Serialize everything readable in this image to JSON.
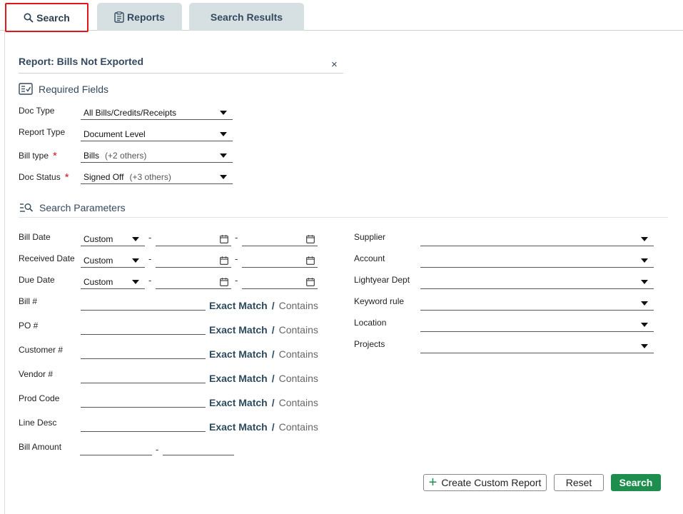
{
  "tabs": [
    {
      "label": "Search",
      "icon": "search-icon",
      "active": true
    },
    {
      "label": "Reports",
      "icon": "clipboard-icon",
      "active": false
    },
    {
      "label": "Search Results",
      "active": false
    }
  ],
  "report": {
    "title": "Report: Bills Not Exported",
    "close": "×"
  },
  "required": {
    "heading": "Required Fields",
    "doc_type": {
      "label": "Doc Type",
      "value": "All Bills/Credits/Receipts"
    },
    "report_type": {
      "label": "Report Type",
      "value": "Document Level"
    },
    "bill_type": {
      "label": "Bill type",
      "value": "Bills",
      "extra": "(+2 others)",
      "required_mark": "*"
    },
    "doc_status": {
      "label": "Doc Status",
      "value": "Signed Off",
      "extra": "(+3 others)",
      "required_mark": "*"
    }
  },
  "params": {
    "heading": "Search Parameters",
    "dates": [
      {
        "label": "Bill Date",
        "mode": "Custom",
        "sep": "-"
      },
      {
        "label": "Received Date",
        "mode": "Custom",
        "sep": "-"
      },
      {
        "label": "Due Date",
        "mode": "Custom",
        "sep": "-"
      }
    ],
    "text_fields": [
      {
        "label": "Bill #",
        "exact": "Exact Match",
        "slash": "/",
        "contains": "Contains"
      },
      {
        "label": "PO #",
        "exact": "Exact Match",
        "slash": "/",
        "contains": "Contains"
      },
      {
        "label": "Customer #",
        "exact": "Exact Match",
        "slash": "/",
        "contains": "Contains"
      },
      {
        "label": "Vendor #",
        "exact": "Exact Match",
        "slash": "/",
        "contains": "Contains"
      },
      {
        "label": "Prod Code",
        "exact": "Exact Match",
        "slash": "/",
        "contains": "Contains"
      },
      {
        "label": "Line Desc",
        "exact": "Exact Match",
        "slash": "/",
        "contains": "Contains"
      }
    ],
    "bill_amount": {
      "label": "Bill Amount",
      "sep": "-"
    },
    "right_fields": [
      {
        "label": "Supplier"
      },
      {
        "label": "Account"
      },
      {
        "label": "Lightyear Dept"
      },
      {
        "label": "Keyword rule"
      },
      {
        "label": "Location"
      },
      {
        "label": "Projects"
      }
    ]
  },
  "actions": {
    "create": "Create Custom Report",
    "reset": "Reset",
    "search": "Search"
  },
  "colors": {
    "accent_green": "#1e8e4e",
    "active_tab_border": "#e0161b",
    "required": "#d0121b"
  }
}
